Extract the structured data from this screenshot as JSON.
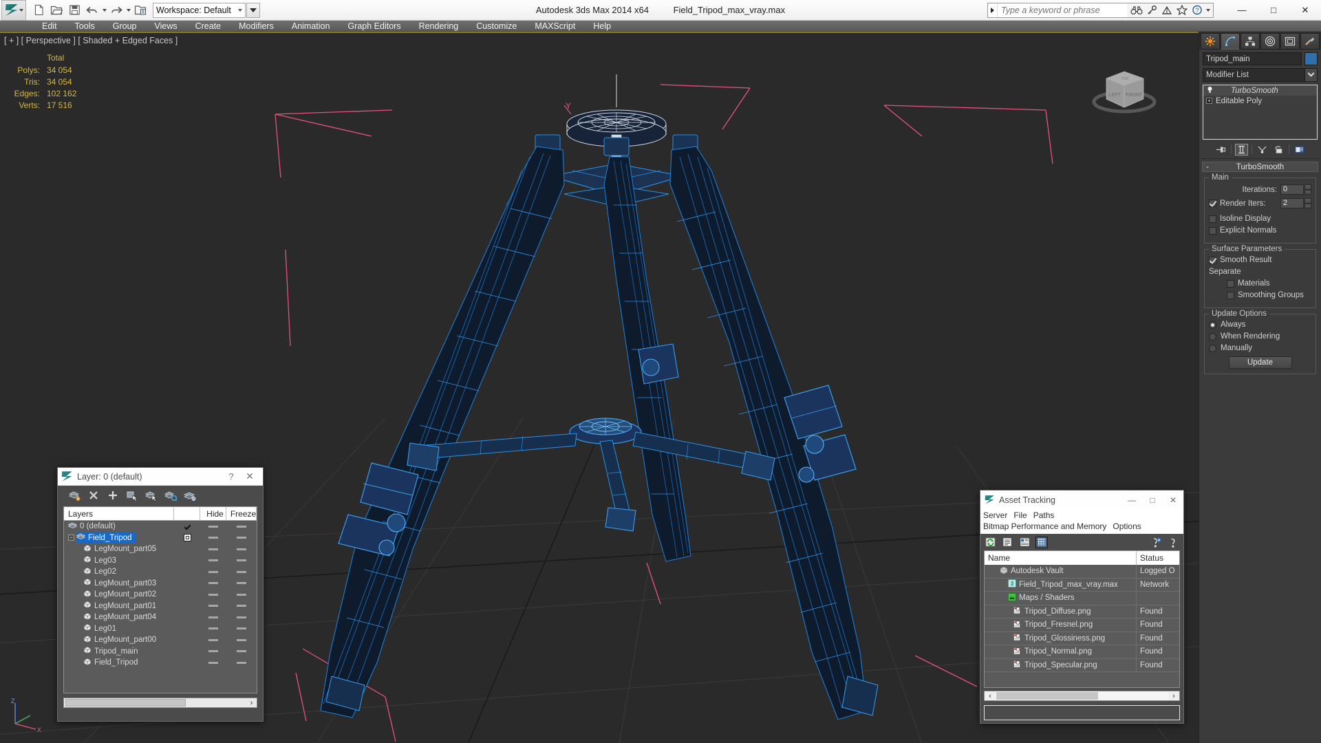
{
  "titlebar": {
    "app_title": "Autodesk 3ds Max  2014 x64",
    "file_name": "Field_Tripod_max_vray.max",
    "workspace_label": "Workspace: Default",
    "search_placeholder": "Type a keyword or phrase",
    "window_buttons": {
      "minimize": "—",
      "maximize": "□",
      "close": "✕"
    },
    "qat_icons": [
      "new-file-icon",
      "open-file-icon",
      "save-file-icon",
      "undo-icon",
      "redo-icon",
      "project-folder-icon"
    ],
    "search_icons": [
      "binoculars-icon",
      "key-icon",
      "satellite-icon",
      "star-icon",
      "help-icon"
    ]
  },
  "menubar": {
    "items": [
      "Edit",
      "Tools",
      "Group",
      "Views",
      "Create",
      "Modifiers",
      "Animation",
      "Graph Editors",
      "Rendering",
      "Customize",
      "MAXScript",
      "Help"
    ]
  },
  "viewport": {
    "label": "[ + ] [ Perspective ] [ Shaded + Edged Faces ]",
    "stats": {
      "header": "Total",
      "rows": [
        {
          "key": "Polys:",
          "value": "34 054"
        },
        {
          "key": "Tris:",
          "value": "34 054"
        },
        {
          "key": "Edges:",
          "value": "102 162"
        },
        {
          "key": "Verts:",
          "value": "17 516"
        }
      ]
    },
    "axis_labels": {
      "x": "X",
      "y": "Y",
      "z": "Z"
    },
    "viewcube_faces": {
      "left": "LEFT",
      "front": "FRONT",
      "top": "TOP"
    },
    "gizmo_y_label": "Y",
    "colors": {
      "background": "#2a2a2a",
      "wireframe": "#1d7fd6",
      "selection_bracket": "#e8527d",
      "grid": "#3c3c3c"
    }
  },
  "command_panel": {
    "tabs": [
      "create-tab",
      "modify-tab",
      "hierarchy-tab",
      "motion-tab",
      "display-tab",
      "utilities-tab"
    ],
    "active_tab_index": 1,
    "object_name": "Tripod_main",
    "object_color": "#2f6fad",
    "modifier_list_label": "Modifier List",
    "stack": [
      {
        "label": "TurboSmooth",
        "selected": true,
        "italic": true,
        "icon": "lightbulb-icon"
      },
      {
        "label": "Editable Poly",
        "selected": false,
        "italic": false,
        "icon": "plus-box-icon"
      }
    ],
    "stack_tools": [
      "pin-stack-icon",
      "show-end-result-icon",
      "make-unique-icon",
      "remove-modifier-icon",
      "configure-sets-icon"
    ],
    "rollout": {
      "collapse_sign": "-",
      "title": "TurboSmooth",
      "main_group": {
        "title": "Main",
        "iterations_label": "Iterations:",
        "iterations_value": "0",
        "render_iters_label": "Render Iters:",
        "render_iters_value": "2",
        "render_iters_checked": true,
        "isoline_display_label": "Isoline Display",
        "isoline_display_checked": false,
        "explicit_normals_label": "Explicit Normals",
        "explicit_normals_checked": false
      },
      "surface_group": {
        "title": "Surface Parameters",
        "smooth_result_label": "Smooth Result",
        "smooth_result_checked": true,
        "separate_label": "Separate",
        "materials_label": "Materials",
        "materials_checked": false,
        "smoothing_groups_label": "Smoothing Groups",
        "smoothing_groups_checked": false
      },
      "update_group": {
        "title": "Update Options",
        "options": [
          {
            "label": "Always",
            "selected": true
          },
          {
            "label": "When Rendering",
            "selected": false
          },
          {
            "label": "Manually",
            "selected": false
          }
        ],
        "update_button": "Update"
      }
    }
  },
  "layer_dialog": {
    "title": "Layer: 0 (default)",
    "help_label": "?",
    "close_label": "✕",
    "toolbar_icons": [
      "new-layer-icon",
      "delete-layer-icon",
      "add-layer-icon",
      "select-objects-icon",
      "select-highlighted-icon",
      "highlight-selected-icon",
      "layer-properties-icon"
    ],
    "columns": {
      "name": "Layers",
      "hide": "Hide",
      "freeze": "Freeze"
    },
    "rows": [
      {
        "label": "0 (default)",
        "indent": 0,
        "icon": "layer-icon",
        "state": "check",
        "selected": false,
        "expander": ""
      },
      {
        "label": "Field_Tripod",
        "indent": 0,
        "icon": "layer-icon",
        "state": "box",
        "selected": true,
        "expander": "-"
      },
      {
        "label": "LegMount_part05",
        "indent": 1,
        "icon": "object-icon",
        "state": "",
        "selected": false,
        "expander": ""
      },
      {
        "label": "Leg03",
        "indent": 1,
        "icon": "object-icon",
        "state": "",
        "selected": false,
        "expander": ""
      },
      {
        "label": "Leg02",
        "indent": 1,
        "icon": "object-icon",
        "state": "",
        "selected": false,
        "expander": ""
      },
      {
        "label": "LegMount_part03",
        "indent": 1,
        "icon": "object-icon",
        "state": "",
        "selected": false,
        "expander": ""
      },
      {
        "label": "LegMount_part02",
        "indent": 1,
        "icon": "object-icon",
        "state": "",
        "selected": false,
        "expander": ""
      },
      {
        "label": "LegMount_part01",
        "indent": 1,
        "icon": "object-icon",
        "state": "",
        "selected": false,
        "expander": ""
      },
      {
        "label": "LegMount_part04",
        "indent": 1,
        "icon": "object-icon",
        "state": "",
        "selected": false,
        "expander": ""
      },
      {
        "label": "Leg01",
        "indent": 1,
        "icon": "object-icon",
        "state": "",
        "selected": false,
        "expander": ""
      },
      {
        "label": "LegMount_part00",
        "indent": 1,
        "icon": "object-icon",
        "state": "",
        "selected": false,
        "expander": ""
      },
      {
        "label": "Tripod_main",
        "indent": 1,
        "icon": "object-icon",
        "state": "",
        "selected": false,
        "expander": ""
      },
      {
        "label": "Field_Tripod",
        "indent": 1,
        "icon": "object-icon",
        "state": "",
        "selected": false,
        "expander": ""
      }
    ]
  },
  "asset_dialog": {
    "title": "Asset Tracking",
    "window_buttons": {
      "minimize": "—",
      "maximize": "□",
      "close": "✕"
    },
    "menu_row1": [
      "Server",
      "File",
      "Paths"
    ],
    "menu_row2": [
      "Bitmap Performance and Memory",
      "Options"
    ],
    "toolbar_icons": [
      "refresh-icon",
      "list-view-icon",
      "detail-view-icon",
      "grid-view-icon",
      "help-add-icon",
      "help-icon"
    ],
    "columns": {
      "name": "Name",
      "status": "Status"
    },
    "rows": [
      {
        "name": "Autodesk Vault",
        "status": "Logged O",
        "depth": 0,
        "icon": "vault-icon"
      },
      {
        "name": "Field_Tripod_max_vray.max",
        "status": "Network",
        "depth": 1,
        "icon": "max-file-icon"
      },
      {
        "name": "Maps / Shaders",
        "status": "",
        "depth": 1,
        "icon": "maps-icon"
      },
      {
        "name": "Tripod_Diffuse.png",
        "status": "Found",
        "depth": 2,
        "icon": "png-icon"
      },
      {
        "name": "Tripod_Fresnel.png",
        "status": "Found",
        "depth": 2,
        "icon": "png-icon"
      },
      {
        "name": "Tripod_Glossiness.png",
        "status": "Found",
        "depth": 2,
        "icon": "png-icon"
      },
      {
        "name": "Tripod_Normal.png",
        "status": "Found",
        "depth": 2,
        "icon": "png-icon"
      },
      {
        "name": "Tripod_Specular.png",
        "status": "Found",
        "depth": 2,
        "icon": "png-icon"
      }
    ],
    "hscroll": {
      "left": "‹",
      "right": "›"
    },
    "status_bar_text": ""
  }
}
